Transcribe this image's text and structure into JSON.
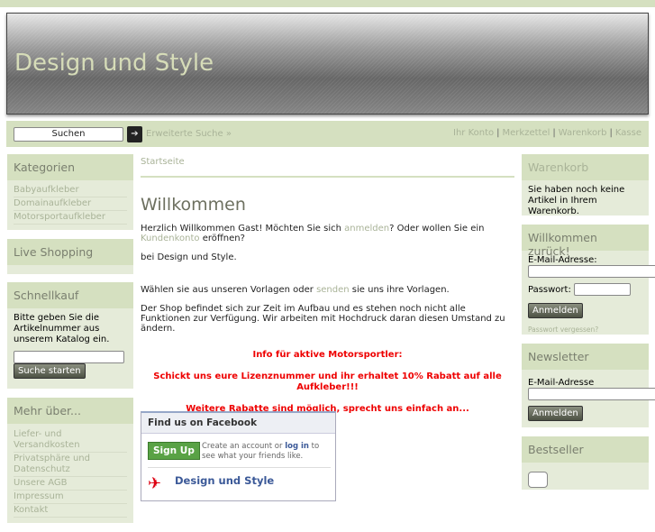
{
  "header": {
    "title": "Design und Style"
  },
  "nav": {
    "search_value": "Suchen",
    "advanced_search": "Erweiterte Suche »",
    "links": [
      "Ihr Konto",
      "Merkzettel",
      "Warenkorb",
      "Kasse"
    ]
  },
  "left": {
    "categories": {
      "title": "Kategorien",
      "items": [
        "Babyaufkleber",
        "Domainaufkleber",
        "Motorsportaufkleber"
      ]
    },
    "live": {
      "title": "Live Shopping"
    },
    "quick": {
      "title": "Schnellkauf",
      "text": "Bitte geben Sie die Artikelnummer aus unserem Katalog ein.",
      "button": "Suche starten"
    },
    "more": {
      "title": "Mehr über...",
      "items": [
        "Liefer- und Versandkosten",
        "Privatsphäre und Datenschutz",
        "Unsere AGB",
        "Impressum",
        "Kontakt"
      ]
    }
  },
  "main": {
    "breadcrumb": "Startseite",
    "title": "Willkommen",
    "p1a": "Herzlich Willkommen Gast! Möchten Sie sich ",
    "p1_link1": "anmelden",
    "p1b": "? Oder wollen Sie ein ",
    "p1_link2": "Kundenkonto",
    "p1c": " eröffnen?",
    "p2": "bei Design und Style.",
    "p3a": "Wählen sie aus unseren Vorlagen oder ",
    "p3_link": "senden",
    "p3b": " sie uns ihre Vorlagen.",
    "p4": "Der Shop befindet sich zur Zeit im Aufbau und es stehen noch nicht alle Funktionen zur Verfügung. Wir arbeiten mit Hochdruck daran diesen Umstand zu ändern.",
    "red1": "Info für aktive Motorsportler:",
    "red2": "Schickt uns eure Lizenznummer und ihr erhaltet 10% Rabatt auf alle Aufkleber!!!",
    "red3": "Weitere Rabatte sind möglich, sprecht uns einfach an..."
  },
  "facebook": {
    "title": "Find us on Facebook",
    "signup": "Sign Up",
    "text_a": "Create an account or ",
    "login": "log in",
    "text_b": " to see what your friends like.",
    "page_name": "Design und Style"
  },
  "right": {
    "cart": {
      "title": "Warenkorb",
      "text": "Sie haben noch keine Artikel in Ihrem Warenkorb."
    },
    "login": {
      "title": "Willkommen zurück!",
      "email_label": "E-Mail-Adresse:",
      "password_label": "Passwort:",
      "button": "Anmelden",
      "forgot": "Passwort vergessen?"
    },
    "newsletter": {
      "title": "Newsletter",
      "email_label": "E-Mail-Adresse",
      "button": "Anmelden"
    },
    "bestseller": {
      "title": "Bestseller"
    }
  }
}
